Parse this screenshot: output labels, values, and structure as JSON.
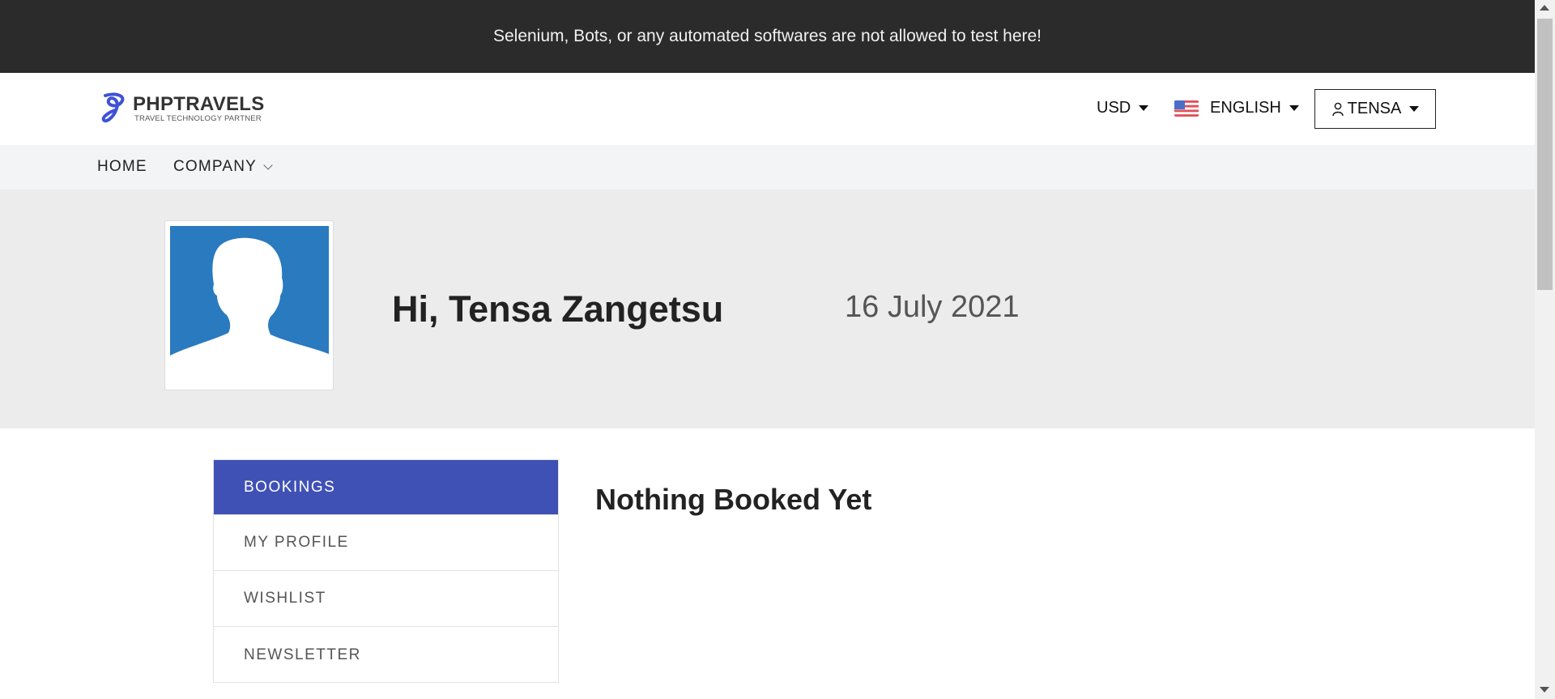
{
  "banner": {
    "text": "Selenium, Bots, or any automated softwares are not allowed to test here!"
  },
  "header": {
    "logo": {
      "main": "PHPTRAVELS",
      "sub": "TRAVEL TECHNOLOGY PARTNER",
      "icon": "phptravels-logo-icon"
    },
    "currency": "USD",
    "language": "ENGLISH",
    "language_flag": "us-flag-icon",
    "user": "TENSA"
  },
  "nav": {
    "items": [
      {
        "label": "HOME"
      },
      {
        "label": "COMPANY"
      }
    ]
  },
  "hero": {
    "greeting": "Hi, Tensa Zangetsu",
    "date": "16 July 2021",
    "avatar_icon": "user-silhouette-icon"
  },
  "menu": {
    "items": [
      {
        "label": "BOOKINGS",
        "active": true
      },
      {
        "label": "MY PROFILE"
      },
      {
        "label": "WISHLIST"
      },
      {
        "label": "NEWSLETTER"
      }
    ]
  },
  "main": {
    "empty_message": "Nothing Booked Yet"
  },
  "colors": {
    "banner_bg": "#2b2b2b",
    "accent": "#3f51b5",
    "avatar_bg": "#2a7abf",
    "hero_bg": "#ececec",
    "nav_bg": "#f3f4f6"
  }
}
